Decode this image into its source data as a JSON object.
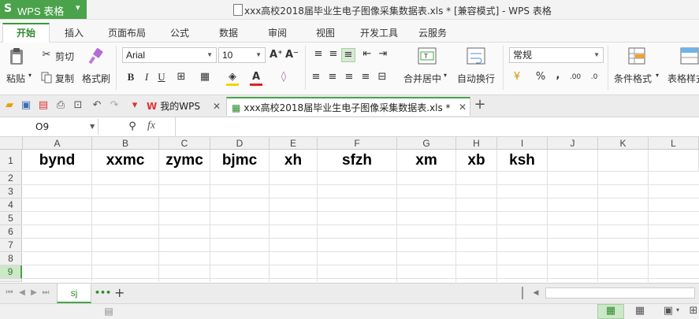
{
  "app": {
    "name": "WPS 表格",
    "window_title": "xxx高校2018届毕业生电子图像采集数据表.xls * [兼容模式] - WPS 表格"
  },
  "menu": {
    "tabs": [
      "开始",
      "插入",
      "页面布局",
      "公式",
      "数据",
      "审阅",
      "视图",
      "开发工具",
      "云服务"
    ],
    "active": "开始"
  },
  "ribbon": {
    "paste": "粘贴",
    "cut": "剪切",
    "copy": "复制",
    "format_painter": "格式刷",
    "font_name": "Arial",
    "font_size": "10",
    "bold": "B",
    "italic": "I",
    "underline": "U",
    "merge_center": "合并居中",
    "wrap_text": "自动换行",
    "number_format": "常规",
    "percent": "%",
    "comma": ",",
    "cond_format": "条件格式",
    "table_style": "表格样式"
  },
  "doc_tabs": {
    "home": "我的WPS",
    "file": "xxx高校2018届毕业生电子图像采集数据表.xls *"
  },
  "formula_bar": {
    "cell_ref": "O9",
    "fx": "fx",
    "content": ""
  },
  "grid": {
    "columns": [
      "A",
      "B",
      "C",
      "D",
      "E",
      "F",
      "G",
      "H",
      "I",
      "J",
      "K",
      "L"
    ],
    "rows": [
      "1",
      "2",
      "3",
      "4",
      "5",
      "6",
      "7",
      "8",
      "9"
    ],
    "selected_row": "9",
    "row1_values": [
      "bynd",
      "xxmc",
      "zymc",
      "bjmc",
      "xh",
      "sfzh",
      "xm",
      "xb",
      "ksh"
    ]
  },
  "sheets": {
    "active": "sj",
    "more": "•••",
    "add": "+"
  },
  "colors": {
    "accent": "#4aa24a",
    "header_bg": "#f0f0f0"
  }
}
